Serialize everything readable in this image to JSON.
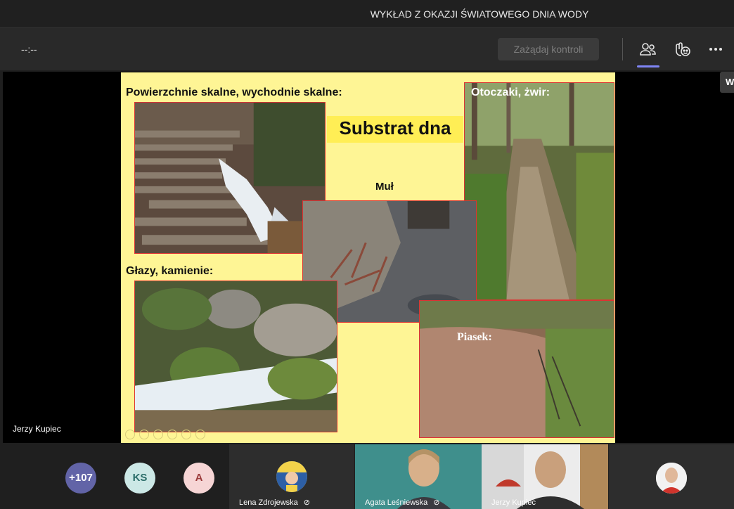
{
  "window": {
    "title": "WYKŁAD Z OKAZJI ŚWIATOWEGO DNIA WODY"
  },
  "toolbar": {
    "timer": "--:--",
    "request_control_label": "Zażądaj kontroli",
    "icons": [
      "people-icon",
      "reactions-icon",
      "more-icon"
    ]
  },
  "tooltip": {
    "text": "W"
  },
  "presenter": {
    "name": "Jerzy Kupiec"
  },
  "slide": {
    "title": "Substrat dna",
    "label_rock": "Powierzchnie skalne, wychodnie skalne:",
    "label_boulders": "Głazy, kamienie:",
    "label_silt": "Muł",
    "label_gravel": "Otoczaki, żwir:",
    "label_sand": "Piasek:"
  },
  "participants": {
    "overflow": "+107",
    "initials": [
      {
        "text": "KS",
        "bg": "#cce8e6",
        "fg": "#2c6e6a"
      },
      {
        "text": "A",
        "bg": "#f6d5d5",
        "fg": "#9b3b3b"
      }
    ],
    "tiles": [
      {
        "name": "Lena Zdrojewska",
        "muted": true
      },
      {
        "name": "Agata Leśniewska",
        "muted": true
      },
      {
        "name": "Jerzy Kupiec",
        "muted": false
      }
    ]
  },
  "colors": {
    "accent": "#7f85f5",
    "slide_bg": "#fef595",
    "photo_border": "#dd3333"
  }
}
